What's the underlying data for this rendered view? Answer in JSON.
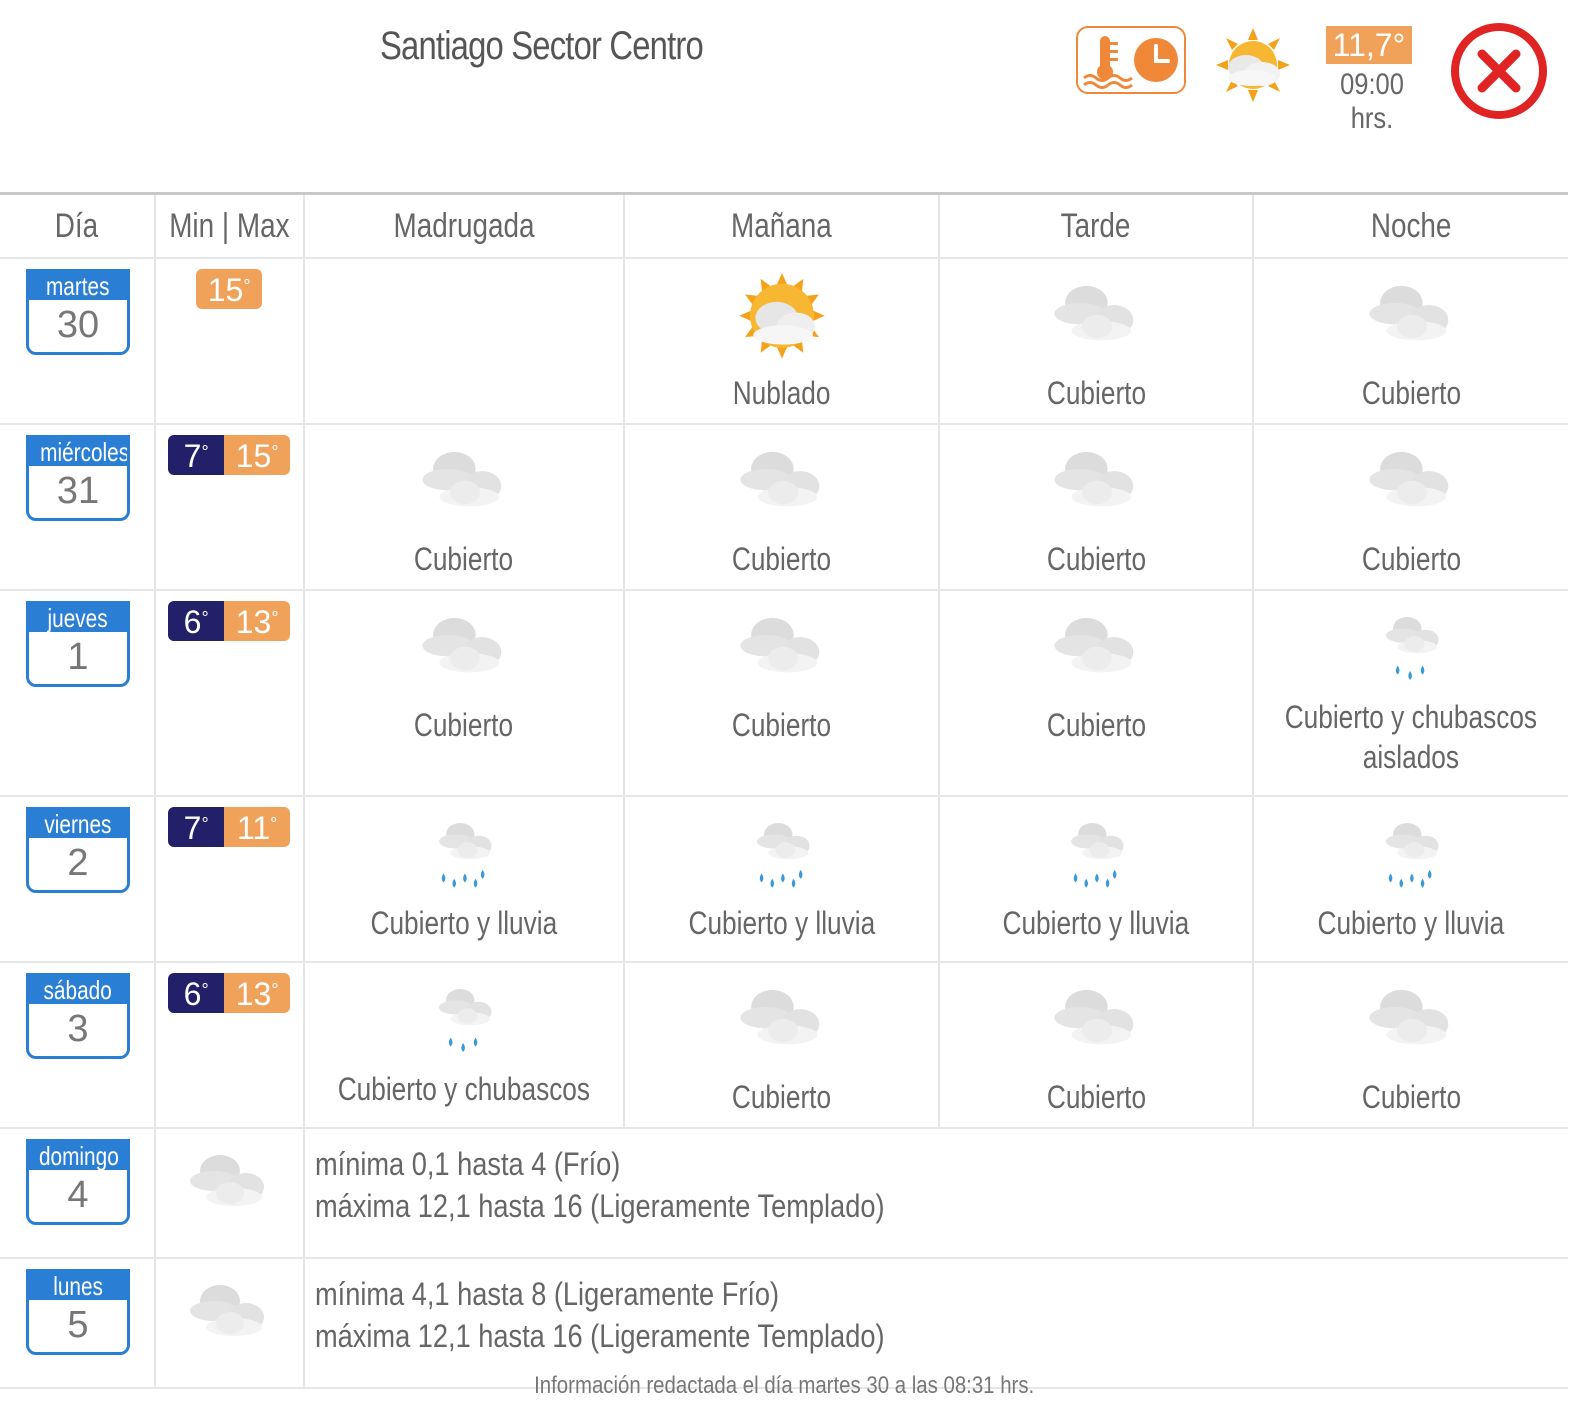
{
  "header": {
    "title": "Santiago Sector Centro",
    "current_temp": "11,7°",
    "current_time": "09:00 hrs.",
    "current_icon": "partly-cloudy-sun-icon",
    "history_icon": "thermometer-clock-icon",
    "close_icon": "close-icon"
  },
  "columns": [
    "Día",
    "Min | Max",
    "Madrugada",
    "Mañana",
    "Tarde",
    "Noche"
  ],
  "days": [
    {
      "name": "martes",
      "num": "30",
      "min": "",
      "max": "15",
      "periods": [
        {
          "icon": "",
          "label": ""
        },
        {
          "icon": "sun-cloud-icon",
          "label": "Nublado"
        },
        {
          "icon": "cloudy-icon",
          "label": "Cubierto"
        },
        {
          "icon": "cloudy-icon",
          "label": "Cubierto"
        }
      ]
    },
    {
      "name": "miércoles",
      "num": "31",
      "min": "7",
      "max": "15",
      "periods": [
        {
          "icon": "cloudy-icon",
          "label": "Cubierto"
        },
        {
          "icon": "cloudy-icon",
          "label": "Cubierto"
        },
        {
          "icon": "cloudy-icon",
          "label": "Cubierto"
        },
        {
          "icon": "cloudy-icon",
          "label": "Cubierto"
        }
      ]
    },
    {
      "name": "jueves",
      "num": "1",
      "min": "6",
      "max": "13",
      "periods": [
        {
          "icon": "cloudy-icon",
          "label": "Cubierto"
        },
        {
          "icon": "cloudy-icon",
          "label": "Cubierto"
        },
        {
          "icon": "cloudy-icon",
          "label": "Cubierto"
        },
        {
          "icon": "showers-icon",
          "label": "Cubierto y chubascos aislados"
        }
      ]
    },
    {
      "name": "viernes",
      "num": "2",
      "min": "7",
      "max": "11",
      "periods": [
        {
          "icon": "rain-icon",
          "label": "Cubierto y lluvia"
        },
        {
          "icon": "rain-icon",
          "label": "Cubierto y lluvia"
        },
        {
          "icon": "rain-icon",
          "label": "Cubierto y lluvia"
        },
        {
          "icon": "rain-icon",
          "label": "Cubierto y lluvia"
        }
      ]
    },
    {
      "name": "sábado",
      "num": "3",
      "min": "6",
      "max": "13",
      "periods": [
        {
          "icon": "showers-icon",
          "label": "Cubierto y chubascos"
        },
        {
          "icon": "cloudy-icon",
          "label": "Cubierto"
        },
        {
          "icon": "cloudy-icon",
          "label": "Cubierto"
        },
        {
          "icon": "cloudy-icon",
          "label": "Cubierto"
        }
      ]
    }
  ],
  "extended": [
    {
      "name": "domingo",
      "num": "4",
      "icon": "cloudy-icon",
      "line1": "mínima 0,1 hasta 4 (Frío)",
      "line2": "máxima 12,1 hasta 16 (Ligeramente Templado)"
    },
    {
      "name": "lunes",
      "num": "5",
      "icon": "cloudy-icon",
      "line1": "mínima 4,1 hasta 8 (Ligeramente Frío)",
      "line2": "máxima 12,1 hasta 16 (Ligeramente Templado)"
    }
  ],
  "footer": "Información redactada el día martes 30 a las 08:31 hrs.",
  "colors": {
    "day_blue": "#2a7fd4",
    "min_navy": "#23206a",
    "max_orange": "#f0a25a",
    "close_red": "#e02424",
    "accent_orange": "#f0883a"
  }
}
